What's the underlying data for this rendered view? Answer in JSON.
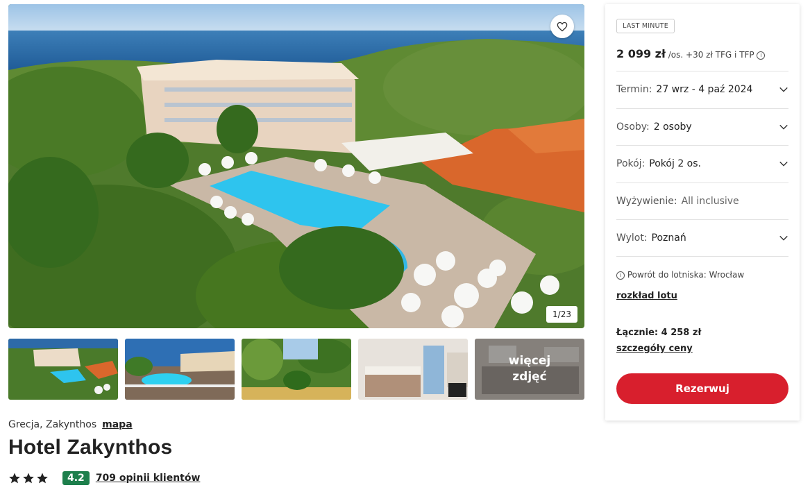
{
  "gallery": {
    "counter": "1/23",
    "favorite_icon": "heart-icon",
    "more_photos_label": "więcej zdjęć"
  },
  "hotel": {
    "location": "Grecja, Zakynthos",
    "map_link": "mapa",
    "name": "Hotel Zakynthos",
    "stars": 3,
    "score": "4.2",
    "reviews": "709 opinii klientów"
  },
  "offer": {
    "badge": "LAST MINUTE",
    "price": "2 099 zł",
    "price_suffix": "/os.",
    "fees": "+30 zł TFG i TFP",
    "fields": {
      "term": {
        "label": "Termin:",
        "value": "27 wrz - 4 paź 2024"
      },
      "persons": {
        "label": "Osoby:",
        "value": "2 osoby"
      },
      "room": {
        "label": "Pokój:",
        "value": "Pokój 2 os."
      },
      "board": {
        "label": "Wyżywienie:",
        "value": "All inclusive"
      },
      "departure": {
        "label": "Wylot:",
        "value": "Poznań"
      }
    },
    "return_info": "Powrót do lotniska: Wrocław",
    "flight_schedule_link": "rozkład lotu",
    "total": "Łącznie: 4 258 zł",
    "price_details_link": "szczegóły ceny",
    "reserve_button": "Rezerwuj"
  },
  "colors": {
    "accent_red": "#d81f2d",
    "score_green": "#1d7f4c"
  }
}
